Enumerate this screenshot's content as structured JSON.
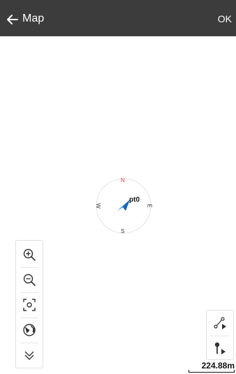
{
  "header": {
    "title": "Map",
    "ok_label": "OK",
    "background": "#3c3c3c"
  },
  "compass": {
    "north": "N",
    "south": "S",
    "west": "W",
    "east": "E",
    "north_color": "#e53935"
  },
  "point": {
    "label": "pt0",
    "arrow_color": "#1e88e5"
  },
  "left_toolbar": {
    "tools": [
      {
        "name": "zoom-in",
        "icon": "zoom-in-icon"
      },
      {
        "name": "zoom-out",
        "icon": "zoom-out-icon"
      },
      {
        "name": "locate",
        "icon": "focus-icon"
      },
      {
        "name": "layers",
        "icon": "globe-icon"
      },
      {
        "name": "collapse",
        "icon": "double-chevron-down-icon"
      }
    ]
  },
  "right_toolbar": {
    "tools": [
      {
        "name": "route-play",
        "icon": "route-play-icon"
      },
      {
        "name": "stake-play",
        "icon": "pin-play-icon"
      }
    ]
  },
  "scale": {
    "text": "224.88m"
  }
}
